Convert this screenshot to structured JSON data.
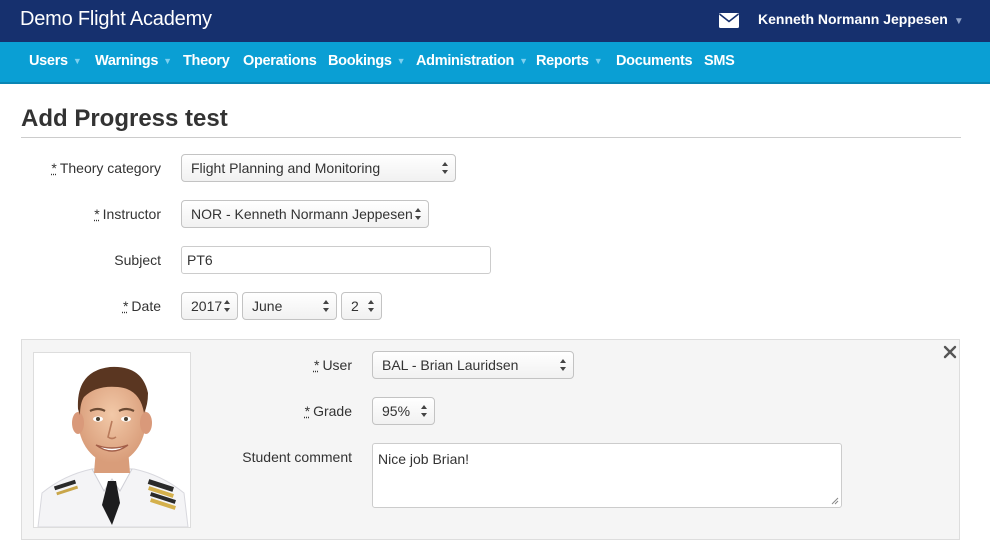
{
  "header": {
    "brand": "Demo Flight Academy",
    "user_name": "Kenneth Normann Jeppesen",
    "mail_icon": "envelope-icon"
  },
  "nav": {
    "items": [
      {
        "label": "Users",
        "dropdown": true
      },
      {
        "label": "Warnings",
        "dropdown": true
      },
      {
        "label": "Theory",
        "dropdown": false
      },
      {
        "label": "Operations",
        "dropdown": false
      },
      {
        "label": "Bookings",
        "dropdown": true
      },
      {
        "label": "Administration",
        "dropdown": true
      },
      {
        "label": "Reports",
        "dropdown": true
      },
      {
        "label": "Documents",
        "dropdown": false
      },
      {
        "label": "SMS",
        "dropdown": false
      }
    ]
  },
  "page": {
    "title": "Add Progress test"
  },
  "form": {
    "required_mark": "*",
    "theory_category": {
      "label": "Theory category",
      "value": "Flight Planning and Monitoring"
    },
    "instructor": {
      "label": "Instructor",
      "value": "NOR - Kenneth Normann Jeppesen"
    },
    "subject": {
      "label": "Subject",
      "value": "PT6"
    },
    "date": {
      "label": "Date",
      "year": "2017",
      "month": "June",
      "day": "2"
    }
  },
  "student": {
    "user": {
      "label": "User",
      "value": "BAL - Brian Lauridsen"
    },
    "grade": {
      "label": "Grade",
      "value": "95%"
    },
    "comment": {
      "label": "Student comment",
      "value": "Nice job Brian!"
    }
  },
  "colors": {
    "topbar": "#16306e",
    "navbar": "#0a9fd4"
  }
}
